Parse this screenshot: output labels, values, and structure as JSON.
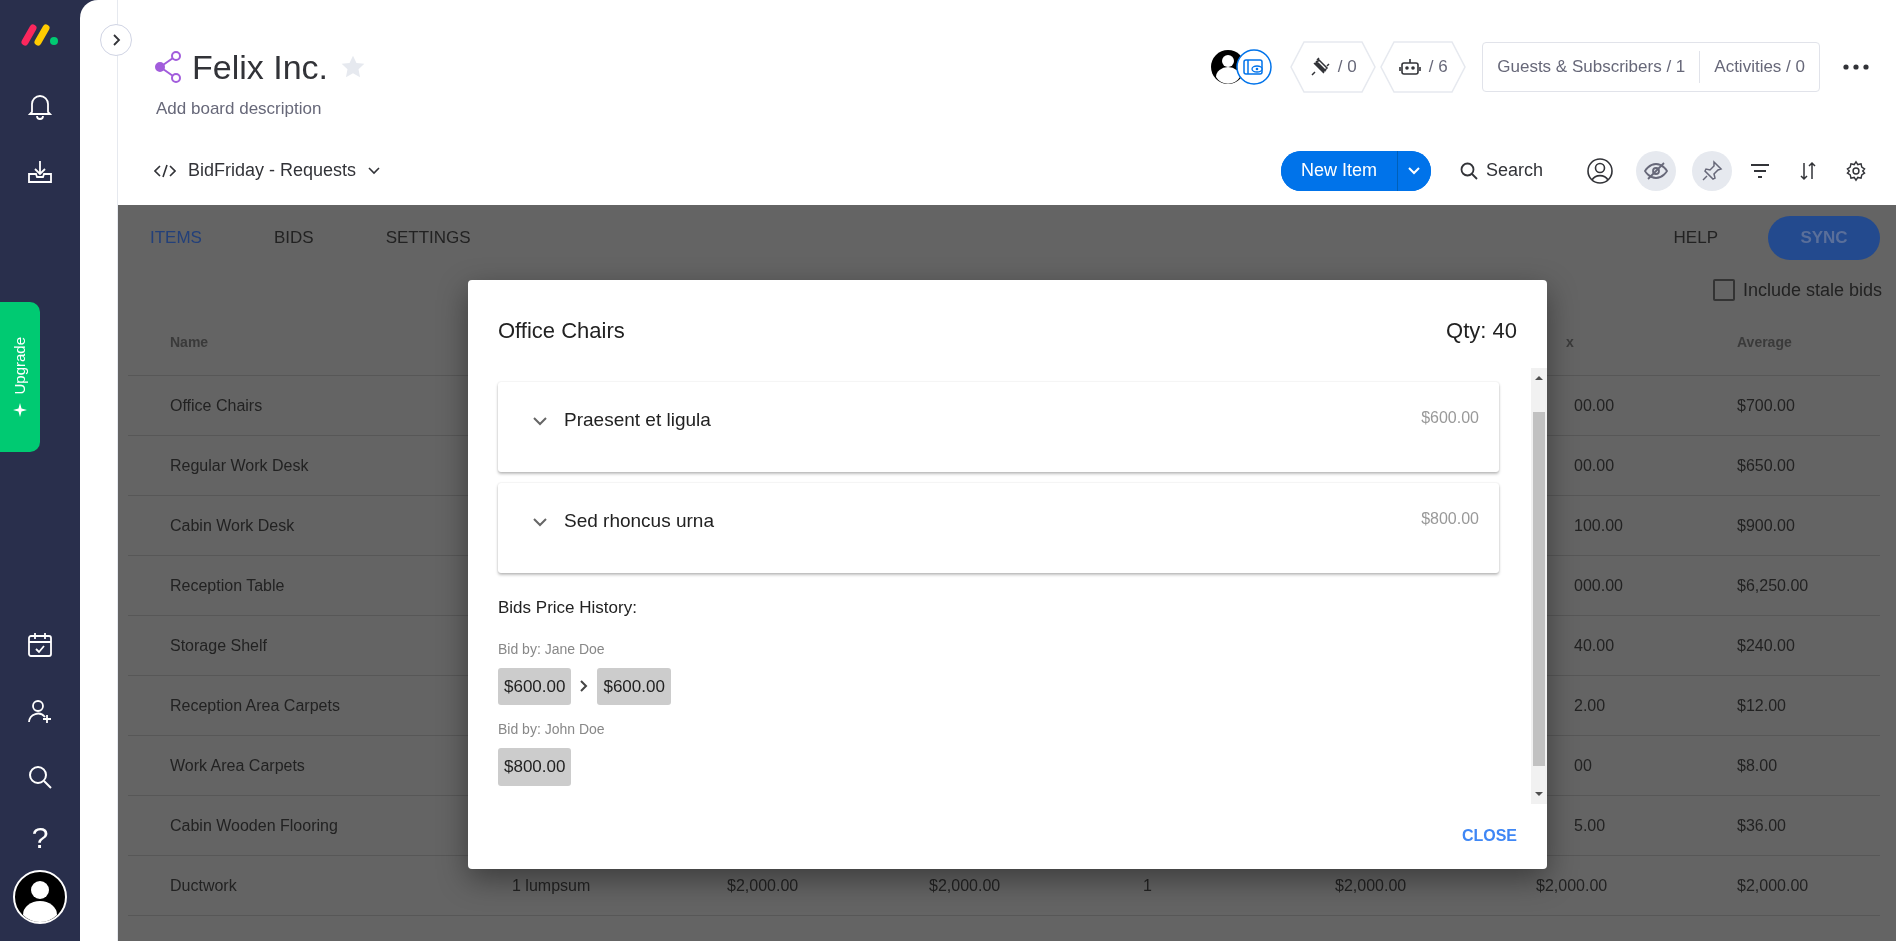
{
  "sidebar": {
    "upgrade": "Upgrade",
    "help": "?"
  },
  "board": {
    "title": "Felix Inc.",
    "starred": false,
    "description": "Add board description",
    "view": "BidFriday - Requests",
    "integrations": "/ 0",
    "automations": "/ 6",
    "guests": "Guests & Subscribers / 1",
    "activities": "Activities / 0"
  },
  "toolbar": {
    "new_item": "New Item",
    "search": "Search"
  },
  "app": {
    "tabs": [
      {
        "label": "ITEMS",
        "selected": true
      },
      {
        "label": "BIDS",
        "selected": false
      },
      {
        "label": "SETTINGS",
        "selected": false
      }
    ],
    "help": "HELP",
    "sync": "SYNC",
    "stale_bids": {
      "label": "Include stale bids",
      "checked": false
    },
    "table": {
      "columns": [
        {
          "label": "Name"
        },
        {},
        {},
        {},
        {},
        {},
        {
          "label": "x"
        },
        {
          "label": "Average"
        }
      ],
      "rows": [
        {
          "cells": [
            "Office Chairs",
            null,
            null,
            null,
            null,
            null,
            "00.00",
            "$700.00"
          ]
        },
        {
          "cells": [
            "Regular Work Desk",
            null,
            null,
            null,
            null,
            null,
            "00.00",
            "$650.00"
          ]
        },
        {
          "cells": [
            "Cabin Work Desk",
            null,
            null,
            null,
            null,
            null,
            "100.00",
            "$900.00"
          ]
        },
        {
          "cells": [
            "Reception Table",
            null,
            null,
            null,
            null,
            null,
            "000.00",
            "$6,250.00"
          ]
        },
        {
          "cells": [
            "Storage Shelf",
            null,
            null,
            null,
            null,
            null,
            "40.00",
            "$240.00"
          ]
        },
        {
          "cells": [
            "Reception Area Carpets",
            null,
            null,
            null,
            null,
            null,
            "2.00",
            "$12.00"
          ]
        },
        {
          "cells": [
            "Work Area Carpets",
            null,
            null,
            null,
            null,
            null,
            "00",
            "$8.00"
          ]
        },
        {
          "cells": [
            "Cabin Wooden Flooring",
            null,
            null,
            null,
            null,
            null,
            "5.00",
            "$36.00"
          ]
        },
        {
          "cells": [
            "Ductwork",
            "1 lumpsum",
            "$2,000.00",
            "$2,000.00",
            "1",
            "$2,000.00",
            "$2,000.00",
            "$2,000.00"
          ]
        }
      ]
    }
  },
  "modal": {
    "title": "Office Chairs",
    "qty": "Qty: 40",
    "bids": [
      {
        "name": "Praesent et ligula",
        "price": "$600.00",
        "expanded": false
      },
      {
        "name": "Sed rhoncus urna",
        "price": "$800.00",
        "expanded": false
      }
    ],
    "history_title": "Bids Price History:",
    "history": [
      {
        "bidder": "Bid by: Jane Doe",
        "prices": [
          "$600.00",
          "$600.00"
        ]
      },
      {
        "bidder": "Bid by: John Doe",
        "prices": [
          "$800.00"
        ]
      }
    ],
    "close": "CLOSE"
  }
}
